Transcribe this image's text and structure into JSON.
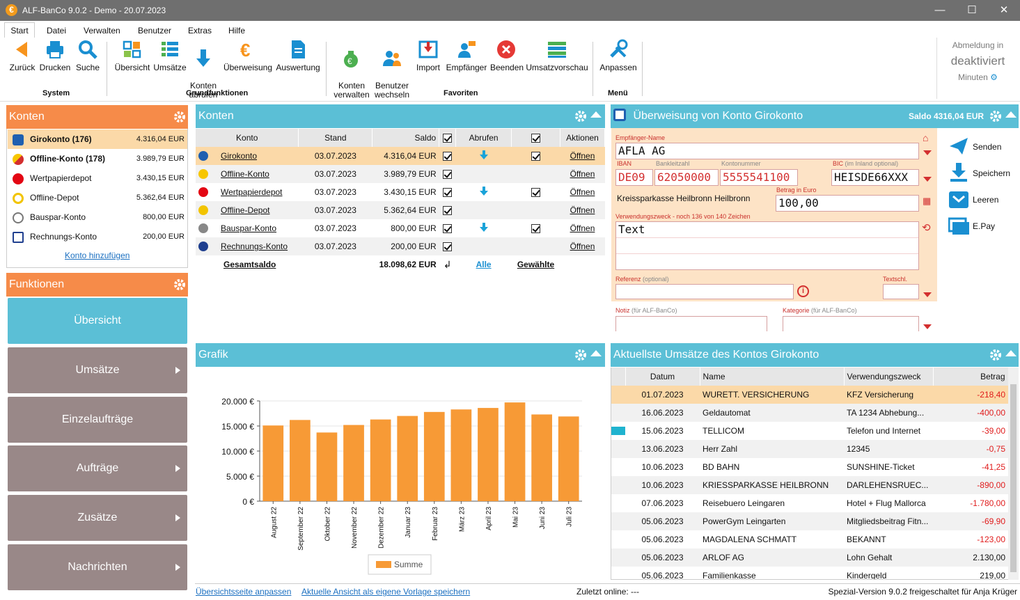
{
  "window": {
    "title": "ALF-BanCo 9.0.2 - Demo  -  20.07.2023",
    "minimize": "—",
    "maximize": "☐",
    "close": "✕"
  },
  "menu": {
    "tabs": [
      "Start",
      "Datei",
      "Verwalten",
      "Benutzer",
      "Extras",
      "Hilfe"
    ]
  },
  "ribbon": {
    "system": {
      "label": "System",
      "buttons": [
        "Zurück",
        "Drucken",
        "Suche"
      ]
    },
    "grund": {
      "label": "Grundfunktionen",
      "buttons": [
        "Übersicht",
        "Umsätze",
        "Konten\nabrufen",
        "Überweisung",
        "Auswertung"
      ]
    },
    "fav": {
      "label": "Favoriten",
      "buttons": [
        "Konten\nverwalten",
        "Benutzer\nwechseln",
        "Import",
        "Empfänger",
        "Beenden",
        "Umsatzvorschau"
      ]
    },
    "menu": {
      "label": "Menü",
      "buttons": [
        "Anpassen"
      ]
    },
    "abmeldung": {
      "line1": "Abmeldung in",
      "line2": "deaktiviert",
      "line3": "Minuten"
    }
  },
  "konten_left": {
    "title": "Konten",
    "add": "Konto hinzufügen",
    "items": [
      {
        "name": "Girokonto (176)",
        "amount": "4.316,04 EUR",
        "bold": true
      },
      {
        "name": "Offline-Konto (178)",
        "amount": "3.989,79 EUR",
        "bold": true
      },
      {
        "name": "Wertpapierdepot",
        "amount": "3.430,15 EUR"
      },
      {
        "name": "Offline-Depot",
        "amount": "5.362,64 EUR"
      },
      {
        "name": "Bauspar-Konto",
        "amount": "800,00 EUR"
      },
      {
        "name": "Rechnungs-Konto",
        "amount": "200,00 EUR"
      }
    ]
  },
  "funktionen": {
    "title": "Funktionen",
    "buttons": [
      "Übersicht",
      "Umsätze",
      "Einzelaufträge",
      "Aufträge",
      "Zusätze",
      "Nachrichten"
    ]
  },
  "konten_table": {
    "title": "Konten",
    "headers": [
      "Konto",
      "Stand",
      "Saldo",
      "Abrufen",
      "Aktionen"
    ],
    "rows": [
      {
        "konto": "Girokonto",
        "stand": "03.07.2023",
        "saldo": "4.316,04 EUR",
        "abrufen": true,
        "aktion": "Öffnen"
      },
      {
        "konto": "Offline-Konto",
        "stand": "03.07.2023",
        "saldo": "3.989,79 EUR",
        "abrufen": false,
        "aktion": "Öffnen"
      },
      {
        "konto": "Wertpapierdepot",
        "stand": "03.07.2023",
        "saldo": "3.430,15 EUR",
        "abrufen": true,
        "aktion": "Öffnen"
      },
      {
        "konto": "Offline-Depot",
        "stand": "03.07.2023",
        "saldo": "5.362,64 EUR",
        "abrufen": false,
        "aktion": "Öffnen"
      },
      {
        "konto": "Bauspar-Konto",
        "stand": "03.07.2023",
        "saldo": "800,00 EUR",
        "abrufen": true,
        "aktion": "Öffnen"
      },
      {
        "konto": "Rechnungs-Konto",
        "stand": "03.07.2023",
        "saldo": "200,00 EUR",
        "abrufen": false,
        "aktion": "Öffnen"
      }
    ],
    "total_label": "Gesamtsaldo",
    "total": "18.098,62 EUR",
    "alle": "Alle",
    "gewaehlte": "Gewählte"
  },
  "ueberweisung": {
    "title": "Überweisung von Konto Girokonto",
    "saldo": "Saldo 4316,04 EUR",
    "empfaenger_label": "Empfänger-Name",
    "empfaenger": "AFLA AG",
    "iban_label": "IBAN",
    "bankleitzahl_label": "Bankleitzahl",
    "kontonummer_label": "Kontonummer",
    "bic_label": "BIC",
    "bic_hint": "(im Inland optional)",
    "iban_prefix": "DE09",
    "blz": "62050000",
    "kontonr": "5555541100",
    "bic": "HEISDE66XXX",
    "bank": "Kreissparkasse Heilbronn Heilbronn",
    "betrag_label": "Betrag in Euro",
    "betrag": "100,00",
    "vz_label": "Verwendungszweck - noch 136 von 140 Zeichen",
    "vz": "Text",
    "referenz_label": "Referenz",
    "optional": "(optional)",
    "textschl_label": "Textschl.",
    "notiz_label": "Notiz",
    "notiz_hint": "(für ALF-BanCo)",
    "kategorie_label": "Kategorie",
    "kategorie_hint": "(für ALF-BanCo)",
    "actions": [
      "Senden",
      "Speichern",
      "Leeren",
      "E.Pay"
    ]
  },
  "grafik": {
    "title": "Grafik",
    "legend": "Summe"
  },
  "chart_data": {
    "type": "bar",
    "categories": [
      "August 22",
      "September 22",
      "Oktober 22",
      "November 22",
      "Dezember 22",
      "Januar 23",
      "Februar 23",
      "März 23",
      "April 23",
      "Mai 23",
      "Juni 23",
      "Juli 23"
    ],
    "series": [
      {
        "name": "Summe",
        "values": [
          15100,
          16200,
          13700,
          15200,
          16300,
          17000,
          17800,
          18300,
          18600,
          19700,
          17300,
          16900
        ]
      }
    ],
    "yticks": [
      "0 €",
      "5.000 €",
      "10.000 €",
      "15.000 €",
      "20.000 €"
    ],
    "ylim": [
      0,
      20000
    ],
    "color": "#f79a36"
  },
  "umsaetze": {
    "title": "Aktuellste Umsätze des Kontos Girokonto",
    "headers": [
      "Datum",
      "Name",
      "Verwendungszweck",
      "Betrag"
    ],
    "rows": [
      {
        "d": "01.07.2023",
        "n": "WURETT. VERSICHERUNG",
        "v": "KFZ Versicherung",
        "b": "-218,40"
      },
      {
        "d": "16.06.2023",
        "n": "Geldautomat",
        "v": "TA 1234 Abhebung...",
        "b": "-400,00"
      },
      {
        "d": "15.06.2023",
        "n": "TELLICOM",
        "v": "Telefon und Internet",
        "b": "-39,00"
      },
      {
        "d": "13.06.2023",
        "n": "Herr Zahl",
        "v": "12345",
        "b": "-0,75"
      },
      {
        "d": "10.06.2023",
        "n": "BD BAHN",
        "v": "SUNSHINE-Ticket",
        "b": "-41,25"
      },
      {
        "d": "10.06.2023",
        "n": "KRIESSPARKASSE HEILBRONN",
        "v": "DARLEHENSRUEC...",
        "b": "-890,00"
      },
      {
        "d": "07.06.2023",
        "n": "Reisebuero Leingaren",
        "v": "Hotel + Flug Mallorca",
        "b": "-1.780,00"
      },
      {
        "d": "05.06.2023",
        "n": "PowerGym Leingarten",
        "v": "Mitgliedsbeitrag Fitn...",
        "b": "-69,90"
      },
      {
        "d": "05.06.2023",
        "n": "MAGDALENA SCHMATT",
        "v": "BEKANNT",
        "b": "-123,00"
      },
      {
        "d": "05.06.2023",
        "n": "ARLOF AG",
        "v": "Lohn Gehalt",
        "b": "2.130,00"
      },
      {
        "d": "05.06.2023",
        "n": "Familienkasse",
        "v": "Kindergeld",
        "b": "219,00"
      }
    ]
  },
  "footer": {
    "link1": "Übersichtsseite anpassen",
    "link2": "Aktuelle Ansicht als eigene Vorlage speichern",
    "online": "Zuletzt online: ---",
    "version": "Spezial-Version 9.0.2 freigeschaltet für Anja Krüger"
  }
}
